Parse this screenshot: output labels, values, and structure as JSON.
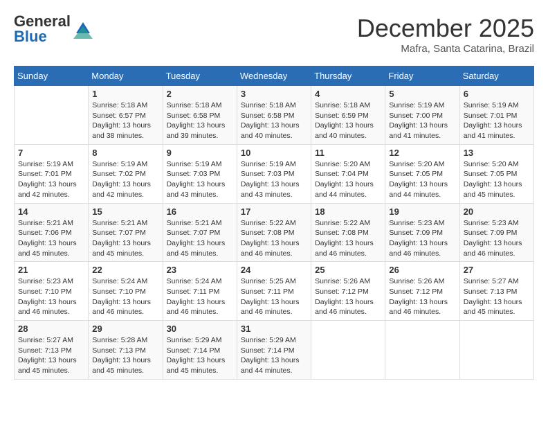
{
  "logo": {
    "general": "General",
    "blue": "Blue"
  },
  "header": {
    "month": "December 2025",
    "location": "Mafra, Santa Catarina, Brazil"
  },
  "days_of_week": [
    "Sunday",
    "Monday",
    "Tuesday",
    "Wednesday",
    "Thursday",
    "Friday",
    "Saturday"
  ],
  "weeks": [
    [
      {
        "day": null
      },
      {
        "day": 1,
        "sunrise": "5:18 AM",
        "sunset": "6:57 PM",
        "daylight": "13 hours and 38 minutes."
      },
      {
        "day": 2,
        "sunrise": "5:18 AM",
        "sunset": "6:58 PM",
        "daylight": "13 hours and 39 minutes."
      },
      {
        "day": 3,
        "sunrise": "5:18 AM",
        "sunset": "6:58 PM",
        "daylight": "13 hours and 40 minutes."
      },
      {
        "day": 4,
        "sunrise": "5:18 AM",
        "sunset": "6:59 PM",
        "daylight": "13 hours and 40 minutes."
      },
      {
        "day": 5,
        "sunrise": "5:19 AM",
        "sunset": "7:00 PM",
        "daylight": "13 hours and 41 minutes."
      },
      {
        "day": 6,
        "sunrise": "5:19 AM",
        "sunset": "7:01 PM",
        "daylight": "13 hours and 41 minutes."
      }
    ],
    [
      {
        "day": 7,
        "sunrise": "5:19 AM",
        "sunset": "7:01 PM",
        "daylight": "13 hours and 42 minutes."
      },
      {
        "day": 8,
        "sunrise": "5:19 AM",
        "sunset": "7:02 PM",
        "daylight": "13 hours and 42 minutes."
      },
      {
        "day": 9,
        "sunrise": "5:19 AM",
        "sunset": "7:03 PM",
        "daylight": "13 hours and 43 minutes."
      },
      {
        "day": 10,
        "sunrise": "5:19 AM",
        "sunset": "7:03 PM",
        "daylight": "13 hours and 43 minutes."
      },
      {
        "day": 11,
        "sunrise": "5:20 AM",
        "sunset": "7:04 PM",
        "daylight": "13 hours and 44 minutes."
      },
      {
        "day": 12,
        "sunrise": "5:20 AM",
        "sunset": "7:05 PM",
        "daylight": "13 hours and 44 minutes."
      },
      {
        "day": 13,
        "sunrise": "5:20 AM",
        "sunset": "7:05 PM",
        "daylight": "13 hours and 45 minutes."
      }
    ],
    [
      {
        "day": 14,
        "sunrise": "5:21 AM",
        "sunset": "7:06 PM",
        "daylight": "13 hours and 45 minutes."
      },
      {
        "day": 15,
        "sunrise": "5:21 AM",
        "sunset": "7:07 PM",
        "daylight": "13 hours and 45 minutes."
      },
      {
        "day": 16,
        "sunrise": "5:21 AM",
        "sunset": "7:07 PM",
        "daylight": "13 hours and 45 minutes."
      },
      {
        "day": 17,
        "sunrise": "5:22 AM",
        "sunset": "7:08 PM",
        "daylight": "13 hours and 46 minutes."
      },
      {
        "day": 18,
        "sunrise": "5:22 AM",
        "sunset": "7:08 PM",
        "daylight": "13 hours and 46 minutes."
      },
      {
        "day": 19,
        "sunrise": "5:23 AM",
        "sunset": "7:09 PM",
        "daylight": "13 hours and 46 minutes."
      },
      {
        "day": 20,
        "sunrise": "5:23 AM",
        "sunset": "7:09 PM",
        "daylight": "13 hours and 46 minutes."
      }
    ],
    [
      {
        "day": 21,
        "sunrise": "5:23 AM",
        "sunset": "7:10 PM",
        "daylight": "13 hours and 46 minutes."
      },
      {
        "day": 22,
        "sunrise": "5:24 AM",
        "sunset": "7:10 PM",
        "daylight": "13 hours and 46 minutes."
      },
      {
        "day": 23,
        "sunrise": "5:24 AM",
        "sunset": "7:11 PM",
        "daylight": "13 hours and 46 minutes."
      },
      {
        "day": 24,
        "sunrise": "5:25 AM",
        "sunset": "7:11 PM",
        "daylight": "13 hours and 46 minutes."
      },
      {
        "day": 25,
        "sunrise": "5:26 AM",
        "sunset": "7:12 PM",
        "daylight": "13 hours and 46 minutes."
      },
      {
        "day": 26,
        "sunrise": "5:26 AM",
        "sunset": "7:12 PM",
        "daylight": "13 hours and 46 minutes."
      },
      {
        "day": 27,
        "sunrise": "5:27 AM",
        "sunset": "7:13 PM",
        "daylight": "13 hours and 45 minutes."
      }
    ],
    [
      {
        "day": 28,
        "sunrise": "5:27 AM",
        "sunset": "7:13 PM",
        "daylight": "13 hours and 45 minutes."
      },
      {
        "day": 29,
        "sunrise": "5:28 AM",
        "sunset": "7:13 PM",
        "daylight": "13 hours and 45 minutes."
      },
      {
        "day": 30,
        "sunrise": "5:29 AM",
        "sunset": "7:14 PM",
        "daylight": "13 hours and 45 minutes."
      },
      {
        "day": 31,
        "sunrise": "5:29 AM",
        "sunset": "7:14 PM",
        "daylight": "13 hours and 44 minutes."
      },
      {
        "day": null
      },
      {
        "day": null
      },
      {
        "day": null
      }
    ]
  ]
}
